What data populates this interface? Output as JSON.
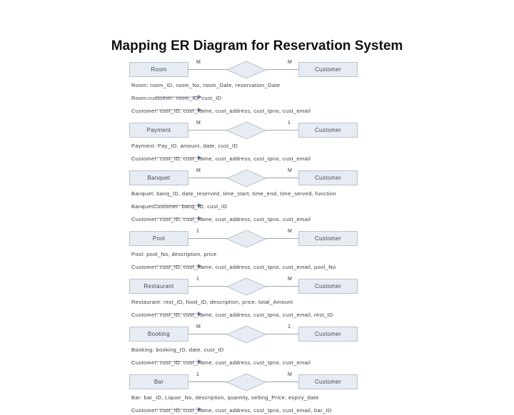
{
  "title": "Mapping ER Diagram for Reservation System",
  "relationships": [
    {
      "left": "Room",
      "right": "Customer",
      "left_card": "M",
      "right_card": "M",
      "schemas": [
        "Room: room_ID, room_No, room_Date, reservation_Date",
        "Room:customer: room_ID, cust_ID",
        "Customer: cust_ID, cust_name, cust_address, cust_tpno, cust_email"
      ]
    },
    {
      "left": "Payment",
      "right": "Customer",
      "left_card": "M",
      "right_card": "1",
      "schemas": [
        "Payment: Pay_ID, amount, date, cust_ID",
        "Customer: cust_ID, cust_name, cust_address, cust_tpno, cust_email"
      ]
    },
    {
      "left": "Banquet",
      "right": "Customer",
      "left_card": "M",
      "right_card": "M",
      "schemas": [
        "Banquet: banq_ID, date_reserved, time_start, time_end, time_served, function",
        "BanquetCustomer: banq_ID, cust_ID",
        "Customer: cust_ID, cust_name, cust_address, cust_tpno, cust_email"
      ]
    },
    {
      "left": "Pool",
      "right": "Customer",
      "left_card": "1",
      "right_card": "M",
      "schemas": [
        "Pool: pool_No, description, price",
        "Customer: cust_ID, cust_name, cust_address, cust_tpno, cust_email, pool_No"
      ]
    },
    {
      "left": "Restaurant",
      "right": "Customer",
      "left_card": "1",
      "right_card": "M",
      "schemas": [
        "Restaurant: rest_ID, food_ID, description, price, total_Amount",
        "Customer: cust_ID, cust_name, cust_address, cust_tpno, cust_email, rest_ID"
      ]
    },
    {
      "left": "Booking",
      "right": "Customer",
      "left_card": "M",
      "right_card": "1",
      "schemas": [
        "Booking: booking_ID, date, cust_ID",
        "Customer: cust_ID, cust_name, cust_address, cust_tpno, cust_email"
      ]
    },
    {
      "left": "Bar",
      "right": "Customer",
      "left_card": "1",
      "right_card": "M",
      "schemas": [
        "Bar: bar_ID, Liquor_No, description, quantity, selling_Price, expiry_date",
        "Customer: cust_ID, cust_name, cust_address, cust_tpno, cust_email, bar_ID"
      ]
    }
  ]
}
